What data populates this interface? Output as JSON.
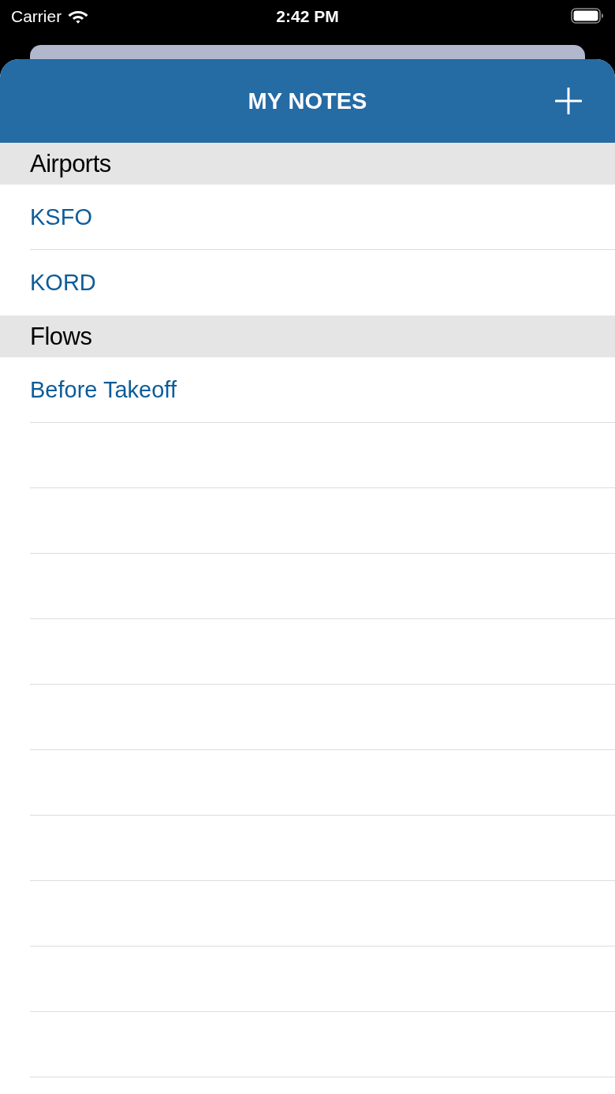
{
  "status_bar": {
    "carrier": "Carrier",
    "time": "2:42 PM"
  },
  "header": {
    "title": "MY NOTES"
  },
  "sections": [
    {
      "title": "Airports",
      "items": [
        "KSFO",
        "KORD"
      ]
    },
    {
      "title": "Flows",
      "items": [
        "Before Takeoff"
      ]
    }
  ]
}
